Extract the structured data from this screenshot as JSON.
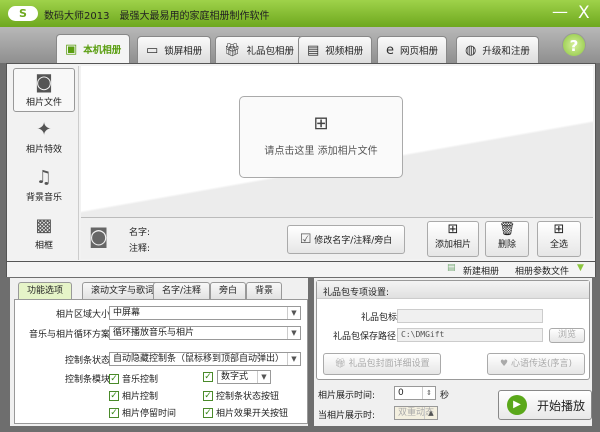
{
  "titlebar": {
    "logo": "S",
    "title": "数码大师2013　最强大最易用的家庭相册制作软件",
    "minimize": "—",
    "close": "X"
  },
  "tabs": [
    {
      "label": "本机相册",
      "icon": "person-frame-icon"
    },
    {
      "label": "锁屏相册",
      "icon": "monitor-icon"
    },
    {
      "label": "礼品包相册",
      "icon": "gift-icon"
    },
    {
      "label": "视频相册",
      "icon": "film-icon"
    },
    {
      "label": "网页相册",
      "icon": "ie-icon"
    },
    {
      "label": "升级和注册",
      "icon": "globe-icon"
    }
  ],
  "help": "?",
  "sidebar": [
    {
      "label": "相片文件"
    },
    {
      "label": "相片特效"
    },
    {
      "label": "背景音乐"
    },
    {
      "label": "相框"
    }
  ],
  "canvas": {
    "add_hint": "请点击这里  添加相片文件"
  },
  "info": {
    "name_label": "名字:",
    "note_label": "注释:",
    "edit_button": "修改名字/注释/旁白",
    "add_button": "添加相片",
    "delete_button": "删除",
    "select_all_button": "全选"
  },
  "toolbar": {
    "new_album": "新建相册",
    "album_params": "相册参数文件"
  },
  "options": {
    "tabs": [
      "功能选项",
      "滚动文字与歌词",
      "名字/注释",
      "旁白",
      "背景"
    ],
    "area_size_label": "相片区域大小:",
    "area_size_value": "中屏幕",
    "loop_label": "音乐与相片循环方案:",
    "loop_value": "循环播放音乐与相片",
    "bar_state_label": "控制条状态:",
    "bar_state_value": "自动隐藏控制条（鼠标移到顶部自动弹出）",
    "bar_module_label": "控制条模块:",
    "checks": [
      {
        "label": "音乐控制",
        "checked": true
      },
      {
        "label": "相片控制",
        "checked": true
      },
      {
        "label": "相片停留时间",
        "checked": true
      },
      {
        "label": "",
        "checked": true
      },
      {
        "label": "控制条状态按钮",
        "checked": true
      },
      {
        "label": "相片效果开关按钮",
        "checked": true
      }
    ],
    "digit_style_value": "数字式"
  },
  "gift": {
    "header": "礼品包专项设置:",
    "title_label": "礼品包标题:",
    "title_value": "",
    "path_label": "礼品包保存路径:",
    "path_value": "C:\\DMGift",
    "browse": "浏览",
    "cover_button": "礼品包封面详细设置",
    "message_button": "心语传送(序言)"
  },
  "playback": {
    "time_label": "相片展示时间:",
    "time_value": "0",
    "unit": "秒",
    "when_label": "当相片展示时:",
    "when_value": "双重动态",
    "start_button": "开始播放"
  }
}
